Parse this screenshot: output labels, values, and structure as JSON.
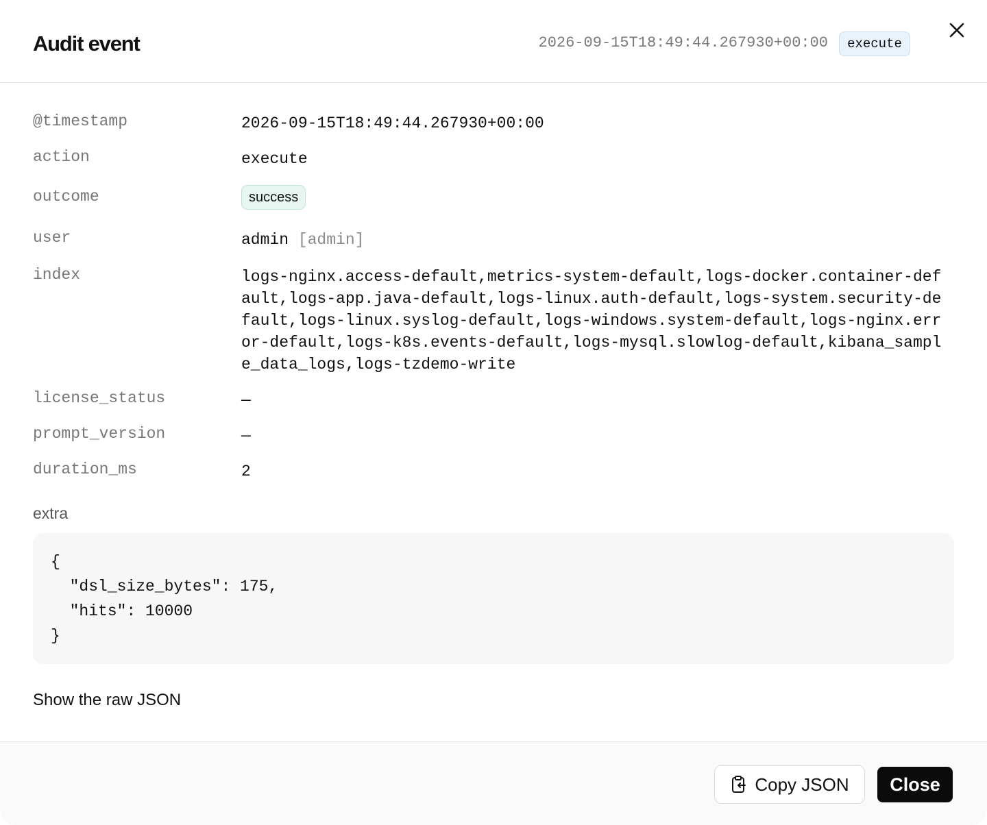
{
  "header": {
    "title": "Audit event",
    "timestamp": "2026-09-15T18:49:44.267930+00:00",
    "action_badge": "execute"
  },
  "fields": {
    "timestamp": {
      "key": "@timestamp",
      "value": "2026-09-15T18:49:44.267930+00:00"
    },
    "action": {
      "key": "action",
      "value": "execute"
    },
    "outcome": {
      "key": "outcome",
      "value": "success"
    },
    "user": {
      "key": "user",
      "value": "admin",
      "roles": "[admin]"
    },
    "index": {
      "key": "index",
      "value": "logs-nginx.access-default,metrics-system-default,logs-docker.container-default,logs-app.java-default,logs-linux.auth-default,logs-system.security-default,logs-linux.syslog-default,logs-windows.system-default,logs-nginx.error-default,logs-k8s.events-default,logs-mysql.slowlog-default,kibana_sample_data_logs,logs-tzdemo-write"
    },
    "license_status": {
      "key": "license_status",
      "value": "—"
    },
    "prompt_version": {
      "key": "prompt_version",
      "value": "—"
    },
    "duration_ms": {
      "key": "duration_ms",
      "value": "2"
    }
  },
  "extra": {
    "label": "extra",
    "json": "{\n  \"dsl_size_bytes\": 175,\n  \"hits\": 10000\n}"
  },
  "raw_json_link": "Show the raw JSON",
  "footer": {
    "copy_label": "Copy JSON",
    "close_label": "Close"
  },
  "icons": {
    "close": "close-icon",
    "clipboard": "clipboard-icon"
  }
}
